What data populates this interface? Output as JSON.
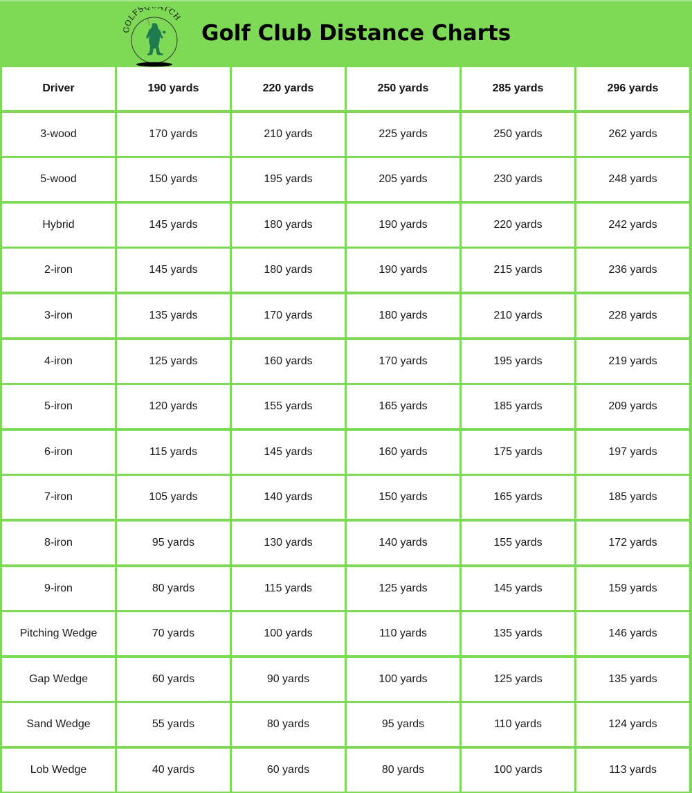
{
  "header": {
    "logo_text": "GOLFSQUATCH",
    "logo_icon": "bigfoot-golfer-icon",
    "title": "Golf Club Distance Charts"
  },
  "colors": {
    "background": "#7ed957",
    "logo_green": "#1f7a4d",
    "cell_background": "#ffffff",
    "text": "#111111"
  },
  "chart_data": {
    "type": "table",
    "title": "Golf Club Distance Charts",
    "columns": [
      "Driver",
      "190 yards",
      "220 yards",
      "250 yards",
      "285 yards",
      "296 yards"
    ],
    "rows": [
      {
        "club": "3-wood",
        "values": [
          "170 yards",
          "210 yards",
          "225 yards",
          "250 yards",
          "262 yards"
        ]
      },
      {
        "club": "5-wood",
        "values": [
          "150 yards",
          "195 yards",
          "205 yards",
          "230 yards",
          "248 yards"
        ]
      },
      {
        "club": "Hybrid",
        "values": [
          "145 yards",
          "180 yards",
          "190 yards",
          "220 yards",
          "242 yards"
        ]
      },
      {
        "club": "2-iron",
        "values": [
          "145 yards",
          "180 yards",
          "190 yards",
          "215 yards",
          "236 yards"
        ]
      },
      {
        "club": "3-iron",
        "values": [
          "135 yards",
          "170 yards",
          "180 yards",
          "210 yards",
          "228 yards"
        ]
      },
      {
        "club": "4-iron",
        "values": [
          "125 yards",
          "160 yards",
          "170 yards",
          "195 yards",
          "219 yards"
        ]
      },
      {
        "club": "5-iron",
        "values": [
          "120 yards",
          "155 yards",
          "165 yards",
          "185 yards",
          "209 yards"
        ]
      },
      {
        "club": "6-iron",
        "values": [
          "115 yards",
          "145 yards",
          "160 yards",
          "175 yards",
          "197 yards"
        ]
      },
      {
        "club": "7-iron",
        "values": [
          "105 yards",
          "140 yards",
          "150 yards",
          "165 yards",
          "185 yards"
        ]
      },
      {
        "club": "8-iron",
        "values": [
          "95 yards",
          "130 yards",
          "140 yards",
          "155 yards",
          "172 yards"
        ]
      },
      {
        "club": "9-iron",
        "values": [
          "80 yards",
          "115 yards",
          "125 yards",
          "145 yards",
          "159 yards"
        ]
      },
      {
        "club": "Pitching Wedge",
        "values": [
          "70 yards",
          "100 yards",
          "110 yards",
          "135 yards",
          "146 yards"
        ]
      },
      {
        "club": "Gap Wedge",
        "values": [
          "60 yards",
          "90 yards",
          "100 yards",
          "125 yards",
          "135 yards"
        ]
      },
      {
        "club": "Sand Wedge",
        "values": [
          "55 yards",
          "80 yards",
          "95 yards",
          "110 yards",
          "124 yards"
        ]
      },
      {
        "club": "Lob Wedge",
        "values": [
          "40 yards",
          "60 yards",
          "80 yards",
          "100 yards",
          "113 yards"
        ]
      }
    ]
  }
}
